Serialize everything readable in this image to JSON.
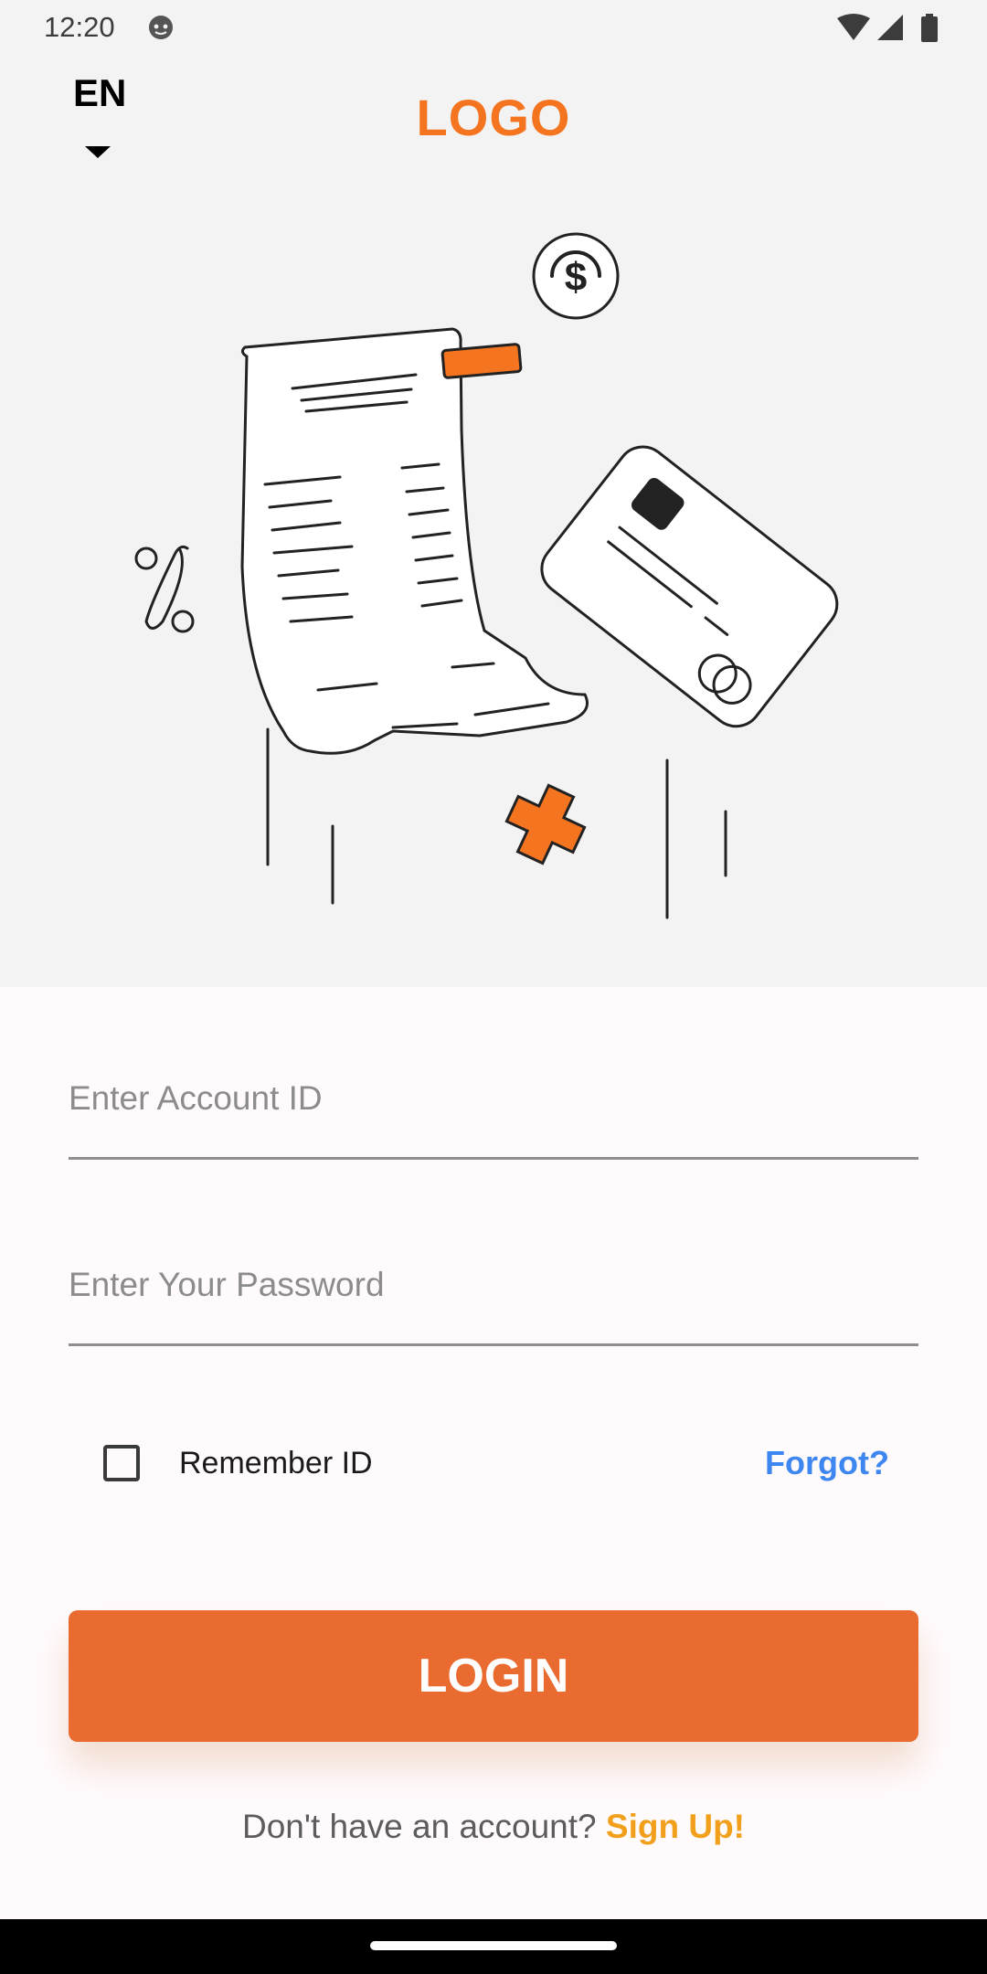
{
  "status_bar": {
    "time": "12:20",
    "icons": [
      "face-icon",
      "wifi-icon",
      "cell-signal-icon",
      "battery-icon"
    ]
  },
  "header": {
    "language": "EN",
    "logo": "LOGO"
  },
  "form": {
    "account_placeholder": "Enter Account ID",
    "password_placeholder": "Enter Your Password",
    "remember_label": "Remember ID",
    "remember_checked": false,
    "forgot_label": "Forgot?",
    "login_label": "LOGIN",
    "signup_prompt": "Don't have an account?",
    "signup_link": "Sign Up!"
  },
  "colors": {
    "accent": "#ea6b30",
    "logo": "#f57420",
    "link_blue": "#3e86f0",
    "signup": "#f2a01b"
  }
}
